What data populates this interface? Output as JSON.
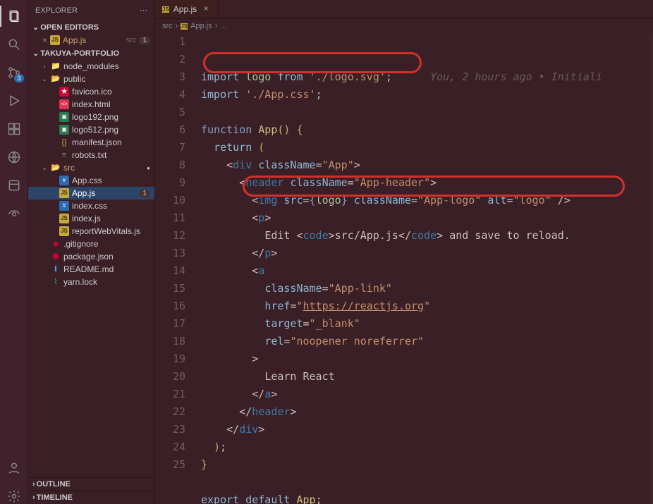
{
  "sidebar": {
    "title": "EXPLORER",
    "open_editors_label": "OPEN EDITORS",
    "open_editors_badge": "1",
    "open_editor_file": "App.js",
    "open_editor_folder": "src",
    "project_label": "TAKUYA-PORTFOLIO",
    "tree": [
      {
        "name": "node_modules",
        "folder": true,
        "indent": 1
      },
      {
        "name": "public",
        "folder": true,
        "open": true,
        "indent": 1
      },
      {
        "name": "favicon.ico",
        "icon": "favicon",
        "indent": 2
      },
      {
        "name": "index.html",
        "icon": "html",
        "indent": 2
      },
      {
        "name": "logo192.png",
        "icon": "img",
        "indent": 2
      },
      {
        "name": "logo512.png",
        "icon": "img",
        "indent": 2
      },
      {
        "name": "manifest.json",
        "icon": "json",
        "indent": 2
      },
      {
        "name": "robots.txt",
        "icon": "txt",
        "indent": 2
      },
      {
        "name": "src",
        "folder": true,
        "open": true,
        "modified": true,
        "indent": 1,
        "dot": true
      },
      {
        "name": "App.css",
        "icon": "css",
        "indent": 2
      },
      {
        "name": "App.js",
        "icon": "js",
        "indent": 2,
        "selected": true,
        "modified": true,
        "badge": "1"
      },
      {
        "name": "index.css",
        "icon": "css",
        "indent": 2
      },
      {
        "name": "index.js",
        "icon": "js",
        "indent": 2
      },
      {
        "name": "reportWebVitals.js",
        "icon": "js",
        "indent": 2
      },
      {
        "name": ".gitignore",
        "icon": "git",
        "indent": 1
      },
      {
        "name": "package.json",
        "icon": "npm",
        "indent": 1
      },
      {
        "name": "README.md",
        "icon": "md",
        "indent": 1
      },
      {
        "name": "yarn.lock",
        "icon": "yarn",
        "indent": 1
      }
    ],
    "outline_label": "OUTLINE",
    "timeline_label": "TIMELINE"
  },
  "tab": {
    "label": "App.js"
  },
  "breadcrumbs": [
    "src",
    "App.js",
    "..."
  ],
  "scm_badge": "3",
  "codelens": "You, 2 hours ago • Initiali",
  "code_lines": [
    {
      "n": 1,
      "html": "<span class='c-import'>import</span> <span class='c-var'>logo</span> <span class='c-import'>from</span> <span class='c-string'>'./logo.svg'</span><span class='c-punc'>;</span>"
    },
    {
      "n": 2,
      "html": "<span class='c-import'>import</span> <span class='c-string'>'./App.css'</span><span class='c-punc'>;</span>"
    },
    {
      "n": 3,
      "html": ""
    },
    {
      "n": 4,
      "html": "<span class='c-keyword'>function</span> <span class='c-fn'>App</span><span class='c-brace'>()</span> <span class='c-brace'>{</span>"
    },
    {
      "n": 5,
      "html": "  <span class='c-import'>return</span> <span class='c-brace'>(</span>"
    },
    {
      "n": 6,
      "html": "    <span class='c-punc'>&lt;</span><span class='c-tag'>div</span> <span class='c-attr'>className</span><span class='c-punc'>=</span><span class='c-val'>\"App\"</span><span class='c-punc'>&gt;</span>"
    },
    {
      "n": 7,
      "html": "      <span class='c-punc'>&lt;</span><span class='c-tag'>header</span> <span class='c-attr'>className</span><span class='c-punc'>=</span><span class='c-val'>\"App-header\"</span><span class='c-punc'>&gt;</span>"
    },
    {
      "n": 8,
      "html": "        <span class='c-punc'>&lt;</span><span class='c-tag'>img</span> <span class='c-attr'>src</span><span class='c-punc'>=</span><span class='c-keyword'>{</span><span class='c-var'>logo</span><span class='c-keyword'>}</span> <span class='c-attr'>className</span><span class='c-punc'>=</span><span class='c-val'>\"App-logo\"</span> <span class='c-attr'>alt</span><span class='c-punc'>=</span><span class='c-val'>\"logo\"</span> <span class='c-punc'>/&gt;</span>"
    },
    {
      "n": 9,
      "html": "        <span class='c-punc'>&lt;</span><span class='c-tag'>p</span><span class='c-punc'>&gt;</span>"
    },
    {
      "n": 10,
      "html": "          <span class='c-txt'>Edit &lt;</span><span class='c-tag'>code</span><span class='c-txt'>&gt;src/App.js&lt;/</span><span class='c-tag'>code</span><span class='c-txt'>&gt; and save to reload.</span>"
    },
    {
      "n": 11,
      "html": "        <span class='c-punc'>&lt;/</span><span class='c-tag'>p</span><span class='c-punc'>&gt;</span>"
    },
    {
      "n": 12,
      "html": "        <span class='c-punc'>&lt;</span><span class='c-tag'>a</span>"
    },
    {
      "n": 13,
      "html": "          <span class='c-attr'>className</span><span class='c-punc'>=</span><span class='c-val'>\"App-link\"</span>"
    },
    {
      "n": 14,
      "html": "          <span class='c-attr'>href</span><span class='c-punc'>=</span><span class='c-val'>\"<span class='c-link'>https://reactjs.org</span>\"</span>"
    },
    {
      "n": 15,
      "html": "          <span class='c-attr'>target</span><span class='c-punc'>=</span><span class='c-val'>\"_blank\"</span>"
    },
    {
      "n": 16,
      "html": "          <span class='c-attr'>rel</span><span class='c-punc'>=</span><span class='c-val'>\"noopener noreferrer\"</span>"
    },
    {
      "n": 17,
      "html": "        <span class='c-punc'>&gt;</span>"
    },
    {
      "n": 18,
      "html": "          <span class='c-txt'>Learn React</span>"
    },
    {
      "n": 19,
      "html": "        <span class='c-punc'>&lt;/</span><span class='c-tag'>a</span><span class='c-punc'>&gt;</span>"
    },
    {
      "n": 20,
      "html": "      <span class='c-punc'>&lt;/</span><span class='c-tag'>header</span><span class='c-punc'>&gt;</span>"
    },
    {
      "n": 21,
      "html": "    <span class='c-punc'>&lt;/</span><span class='c-tag'>div</span><span class='c-punc'>&gt;</span>"
    },
    {
      "n": 22,
      "html": "  <span class='c-brace'>)</span><span class='c-punc'>;</span>"
    },
    {
      "n": 23,
      "html": "<span class='c-brace'>}</span>"
    },
    {
      "n": 24,
      "html": ""
    },
    {
      "n": 25,
      "html": "<span class='c-import'>export</span> <span class='c-import'>default</span> <span class='c-fn'>App</span><span class='c-punc'>;</span>"
    }
  ]
}
